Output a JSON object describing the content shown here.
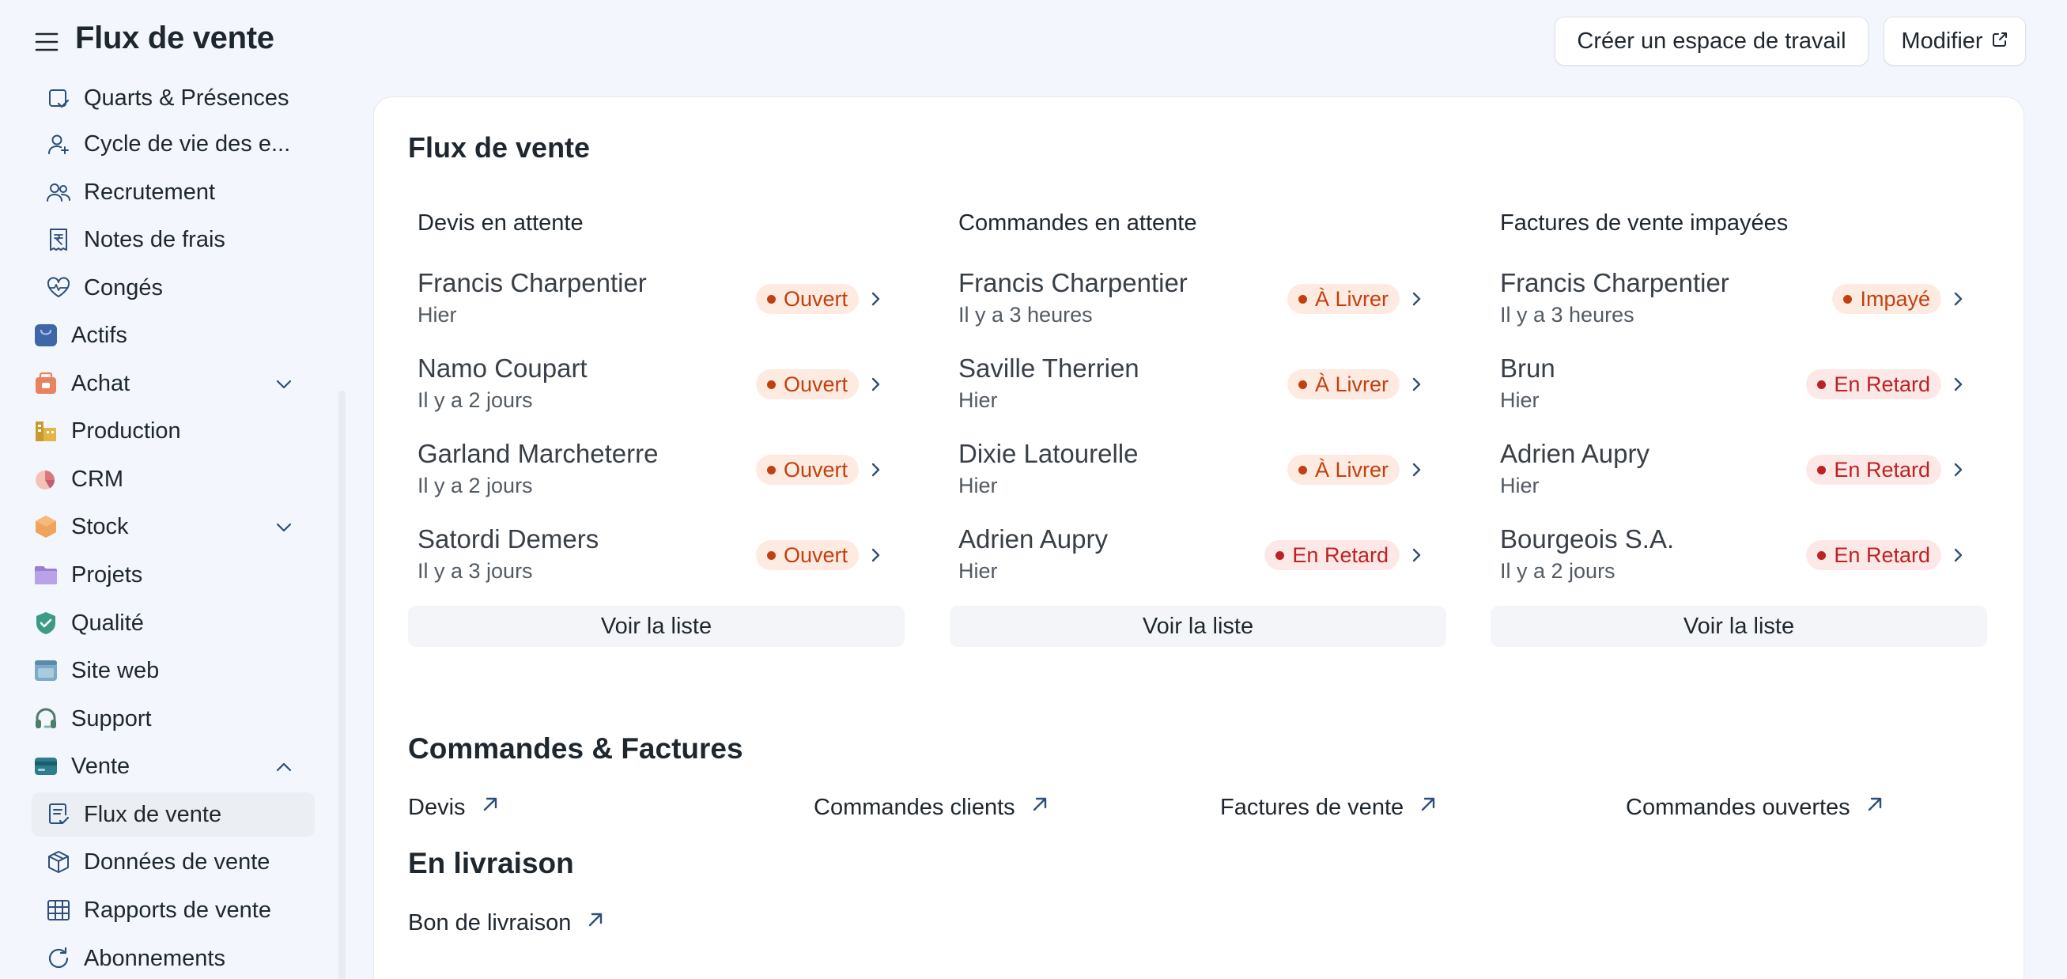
{
  "app_title": "Flux de vente",
  "header": {
    "create_workspace": "Créer un espace de travail",
    "edit": "Modifier"
  },
  "sidebar": {
    "items": [
      {
        "label": "Quarts & Présences",
        "icon": "calendar-check-icon"
      },
      {
        "label": "Cycle de vie des e...",
        "icon": "user-plus-icon"
      },
      {
        "label": "Recrutement",
        "icon": "users-icon"
      },
      {
        "label": "Notes de frais",
        "icon": "rupee-receipt-icon"
      },
      {
        "label": "Congés",
        "icon": "heart-pulse-icon"
      },
      {
        "label": "Actifs",
        "icon": "assets-icon"
      },
      {
        "label": "Achat",
        "icon": "purchase-icon"
      },
      {
        "label": "Production",
        "icon": "factory-icon"
      },
      {
        "label": "CRM",
        "icon": "pie-chart-icon"
      },
      {
        "label": "Stock",
        "icon": "stock-box-icon"
      },
      {
        "label": "Projets",
        "icon": "folder-icon"
      },
      {
        "label": "Qualité",
        "icon": "shield-check-icon"
      },
      {
        "label": "Site web",
        "icon": "website-icon"
      },
      {
        "label": "Support",
        "icon": "headset-icon"
      },
      {
        "label": "Vente",
        "icon": "card-icon"
      },
      {
        "label": "Flux de vente",
        "icon": "file-check-icon"
      },
      {
        "label": "Données de vente",
        "icon": "package-icon"
      },
      {
        "label": "Rapports de vente",
        "icon": "table-icon"
      },
      {
        "label": "Abonnements",
        "icon": "refresh-icon"
      }
    ]
  },
  "main": {
    "title": "Flux de vente",
    "columns": [
      {
        "title": "Devis en attente",
        "rows": [
          {
            "name": "Francis Charpentier",
            "time": "Hier",
            "status": "Ouvert"
          },
          {
            "name": "Namo Coupart",
            "time": "Il y a 2 jours",
            "status": "Ouvert"
          },
          {
            "name": "Garland Marcheterre",
            "time": "Il y a 2 jours",
            "status": "Ouvert"
          },
          {
            "name": "Satordi Demers",
            "time": "Il y a 3 jours",
            "status": "Ouvert"
          }
        ],
        "see_list": "Voir la liste"
      },
      {
        "title": "Commandes en attente",
        "rows": [
          {
            "name": "Francis Charpentier",
            "time": "Il y a 3 heures",
            "status": "À Livrer"
          },
          {
            "name": "Saville Therrien",
            "time": "Hier",
            "status": "À Livrer"
          },
          {
            "name": "Dixie Latourelle",
            "time": "Hier",
            "status": "À Livrer"
          },
          {
            "name": "Adrien Aupry",
            "time": "Hier",
            "status": "En Retard"
          }
        ],
        "see_list": "Voir la liste"
      },
      {
        "title": "Factures de vente impayées",
        "rows": [
          {
            "name": "Francis Charpentier",
            "time": "Il y a 3 heures",
            "status": "Impayé"
          },
          {
            "name": "Brun",
            "time": "Hier",
            "status": "En Retard"
          },
          {
            "name": "Adrien Aupry",
            "time": "Hier",
            "status": "En Retard"
          },
          {
            "name": "Bourgeois S.A.",
            "time": "Il y a 2 jours",
            "status": "En Retard"
          }
        ],
        "see_list": "Voir la liste"
      }
    ],
    "orders_title": "Commandes & Factures",
    "order_links": [
      "Devis",
      "Commandes clients",
      "Factures de vente",
      "Commandes ouvertes"
    ],
    "delivery_title": "En livraison",
    "delivery_links": [
      "Bon de livraison"
    ]
  }
}
